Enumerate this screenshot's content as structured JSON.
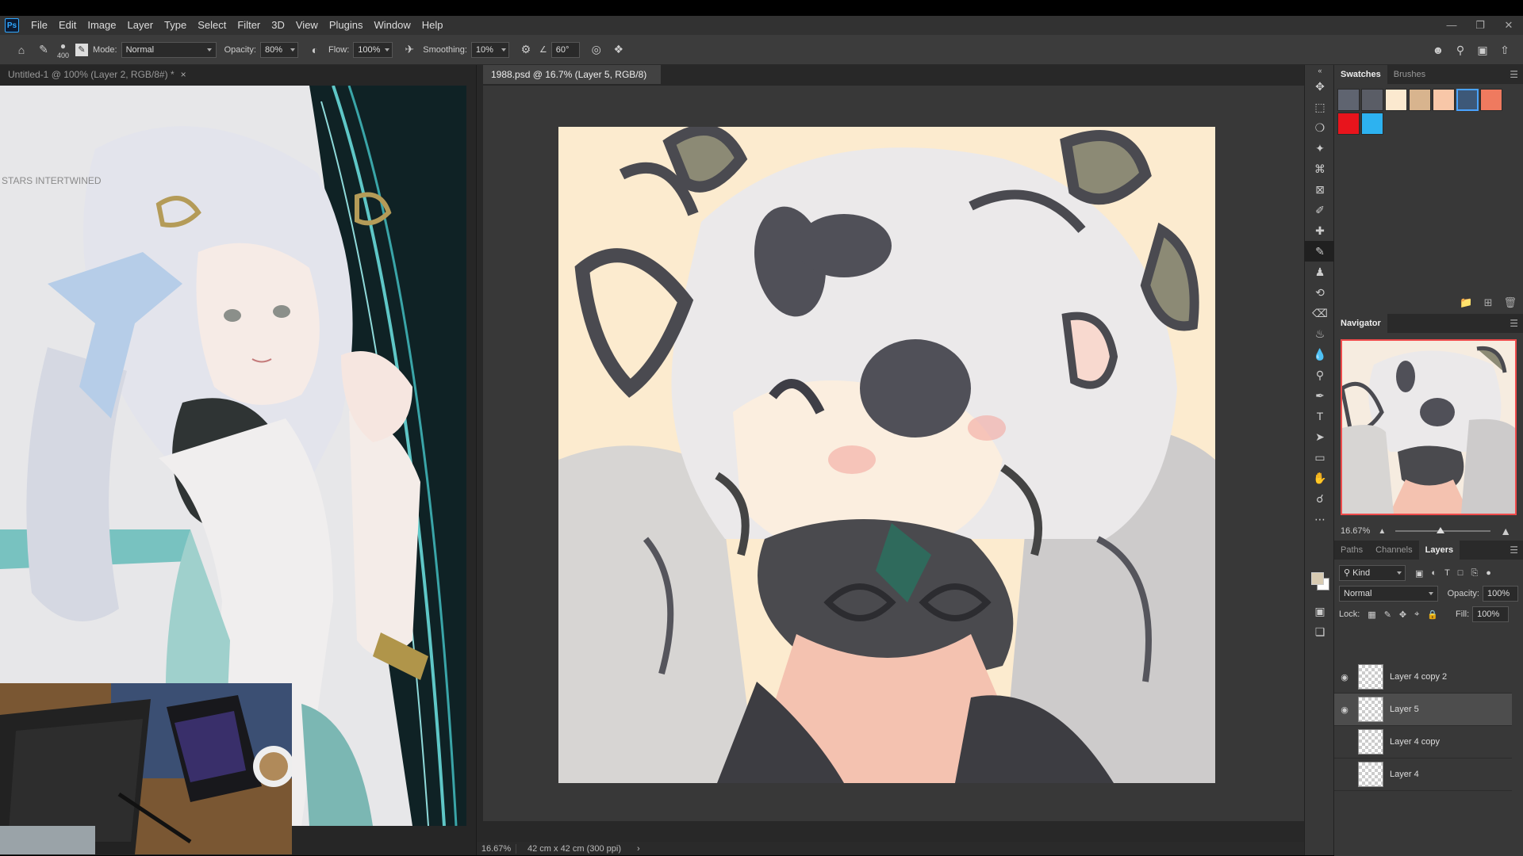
{
  "menubar": {
    "logo": "Ps",
    "items": [
      "File",
      "Edit",
      "Image",
      "Layer",
      "Type",
      "Select",
      "Filter",
      "3D",
      "View",
      "Plugins",
      "Window",
      "Help"
    ]
  },
  "options": {
    "brush_size": "400",
    "mode_label": "Mode:",
    "mode_value": "Normal",
    "opacity_label": "Opacity:",
    "opacity_value": "80%",
    "flow_label": "Flow:",
    "flow_value": "100%",
    "smoothing_label": "Smoothing:",
    "smoothing_value": "10%",
    "angle_value": "60°"
  },
  "documents": {
    "left_tab": "Untitled-1 @ 100% (Layer 2, RGB/8#) *",
    "main_tab": "1988.psd @ 16.7% (Layer 5, RGB/8) *",
    "left_watermark": "STARS INTERTWINED"
  },
  "status": {
    "zoom": "16.67%",
    "doc_size": "42 cm x 42 cm (300 ppi)"
  },
  "swatches": {
    "tabs": [
      "Swatches",
      "Brushes"
    ],
    "colors": [
      "#5f6470",
      "#5a5d66",
      "#fbe9cf",
      "#d8b48e",
      "#f8c7a8",
      "#3d5878",
      "#ef7a5f",
      "#e8141c",
      "#2db2f0"
    ]
  },
  "navigator": {
    "title": "Navigator",
    "zoom": "16.67%"
  },
  "layers_panel": {
    "tabs": [
      "Paths",
      "Channels",
      "Layers"
    ],
    "kind_label": "Kind",
    "blend_mode": "Normal",
    "opacity_label": "Opacity:",
    "opacity_value": "100%",
    "lock_label": "Lock:",
    "fill_label": "Fill:",
    "fill_value": "100%",
    "layers": [
      {
        "name": "Layer 4 copy 2",
        "visible": true
      },
      {
        "name": "Layer 5",
        "visible": true
      },
      {
        "name": "Layer 4 copy",
        "visible": false
      },
      {
        "name": "Layer 4",
        "visible": false
      }
    ]
  },
  "colors": {
    "accent": "#31a8ff",
    "selection": "#ee4b4b"
  }
}
